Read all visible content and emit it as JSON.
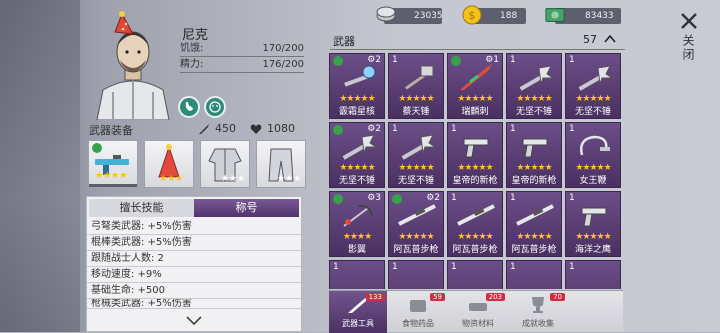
{
  "character": {
    "name": "尼克",
    "hunger_label": "饥饿:",
    "hunger_value": "170/200",
    "energy_label": "精力:",
    "energy_value": "176/200"
  },
  "equipment": {
    "title": "武器装备",
    "attack": "450",
    "defense": "1080",
    "slots": [
      "weapon-slot",
      "hat-slot",
      "armor-slot",
      "pants-slot"
    ]
  },
  "skills": {
    "tabs": [
      "擅长技能",
      "称号"
    ],
    "lines": [
      "弓弩类武器: +5%伤害",
      "棍棒类武器: +5%伤害",
      "跟随战士人数: 2",
      "移动速度: +9%",
      "基础生命: +500",
      "枪械类武器: +5%伤害"
    ]
  },
  "resources": {
    "silver": "23035",
    "gold": "188",
    "cash": "83433"
  },
  "close": {
    "label": "关闭"
  },
  "weapons": {
    "title": "武器",
    "count": "57",
    "items": [
      {
        "num": "",
        "name": "霰霜星核",
        "stars": "★★★★★",
        "gear": "2",
        "kind": "mace",
        "recycle": true
      },
      {
        "num": "1",
        "name": "蔡天锤",
        "stars": "★★★★★",
        "gear": "",
        "kind": "hammer",
        "recycle": false
      },
      {
        "num": "",
        "name": "瑞麟刺",
        "stars": "★★★★★",
        "gear": "1",
        "kind": "spear",
        "recycle": true
      },
      {
        "num": "1",
        "name": "无坚不锤",
        "stars": "★★★★★",
        "gear": "",
        "kind": "spike",
        "recycle": false
      },
      {
        "num": "1",
        "name": "无坚不锤",
        "stars": "★★★★★",
        "gear": "",
        "kind": "spike",
        "recycle": false
      },
      {
        "num": "",
        "name": "无坚不锤",
        "stars": "★★★★★",
        "gear": "2",
        "kind": "spike",
        "recycle": true
      },
      {
        "num": "1",
        "name": "无坚不锤",
        "stars": "★★★★★",
        "gear": "",
        "kind": "spike",
        "recycle": false
      },
      {
        "num": "1",
        "name": "皇帝的新枪",
        "stars": "★★★★★",
        "gear": "",
        "kind": "pistol",
        "recycle": false
      },
      {
        "num": "1",
        "name": "皇帝的新枪",
        "stars": "★★★★★",
        "gear": "",
        "kind": "pistol",
        "recycle": false
      },
      {
        "num": "1",
        "name": "女王鞭",
        "stars": "★★★★★",
        "gear": "",
        "kind": "whip",
        "recycle": false
      },
      {
        "num": "",
        "name": "影翼",
        "stars": "★★★★",
        "gear": "3",
        "kind": "bow",
        "recycle": true
      },
      {
        "num": "",
        "name": "阿瓦普步枪",
        "stars": "★★★★★",
        "gear": "2",
        "kind": "rifle",
        "recycle": true
      },
      {
        "num": "1",
        "name": "阿瓦普步枪",
        "stars": "★★★★★",
        "gear": "",
        "kind": "rifle",
        "recycle": false
      },
      {
        "num": "1",
        "name": "阿瓦普步枪",
        "stars": "★★★★★",
        "gear": "",
        "kind": "rifle",
        "recycle": false
      },
      {
        "num": "1",
        "name": "海洋之鹰",
        "stars": "★★★★★",
        "gear": "",
        "kind": "pistol",
        "recycle": false
      },
      {
        "num": "1",
        "name": "",
        "stars": "",
        "gear": "",
        "kind": "",
        "recycle": false
      },
      {
        "num": "1",
        "name": "",
        "stars": "",
        "gear": "",
        "kind": "",
        "recycle": false
      },
      {
        "num": "1",
        "name": "",
        "stars": "",
        "gear": "",
        "kind": "",
        "recycle": false
      },
      {
        "num": "1",
        "name": "",
        "stars": "",
        "gear": "",
        "kind": "",
        "recycle": false
      },
      {
        "num": "1",
        "name": "",
        "stars": "",
        "gear": "",
        "kind": "",
        "recycle": false
      }
    ]
  },
  "bottom_tabs": [
    {
      "label": "武器工具",
      "count": "133"
    },
    {
      "label": "食物药品",
      "count": "59"
    },
    {
      "label": "物资材料",
      "count": "203"
    },
    {
      "label": "成就收集",
      "count": "70"
    }
  ]
}
